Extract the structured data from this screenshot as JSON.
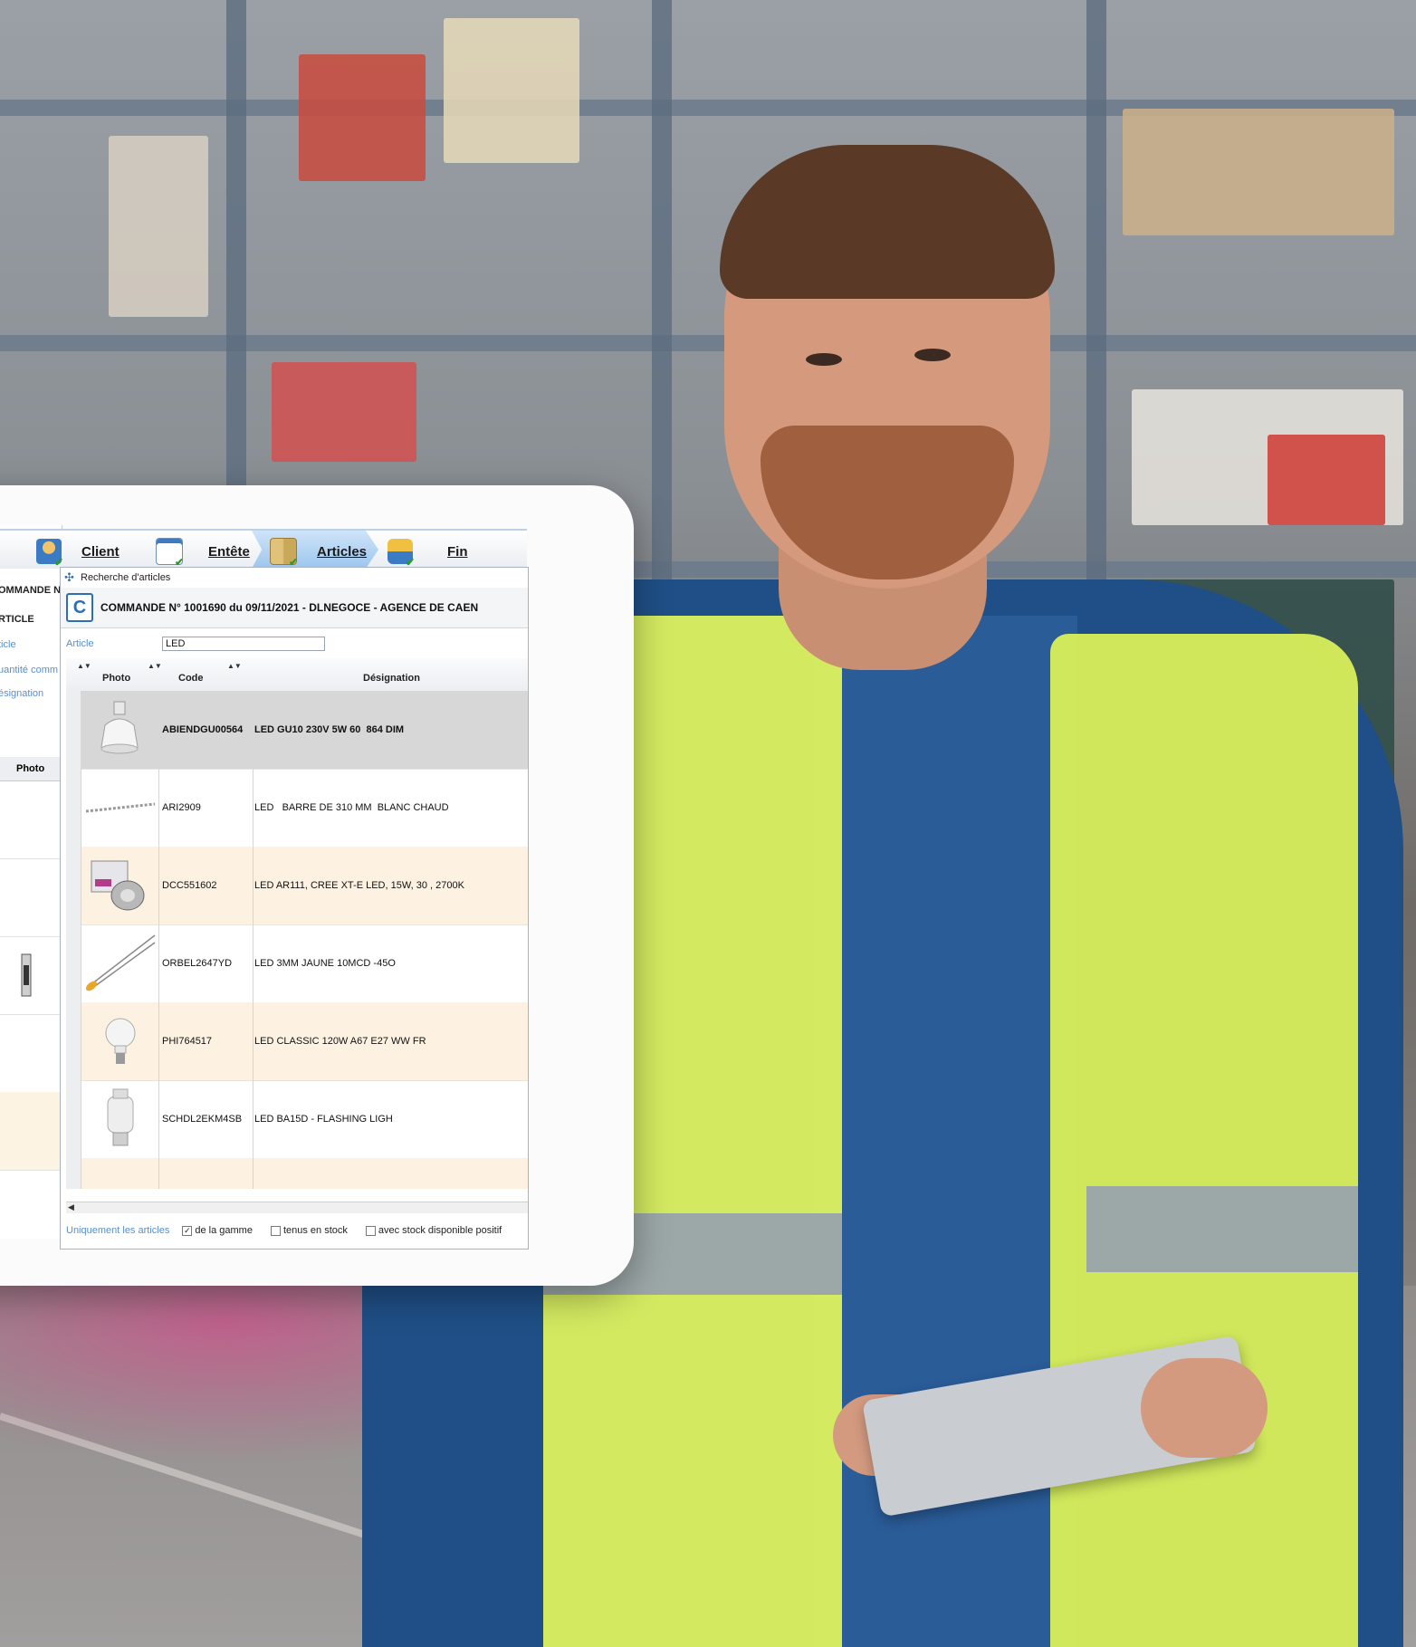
{
  "wizard": {
    "steps": [
      {
        "label": "Client",
        "icon": "client-icon"
      },
      {
        "label": "Entête",
        "icon": "header-form-icon"
      },
      {
        "label": "Articles",
        "icon": "articles-icon",
        "active": true
      },
      {
        "label": "Fin",
        "icon": "finish-truck-icon"
      }
    ]
  },
  "back_window": {
    "order_prefix": "OMMANDE N",
    "section": "RTICLE",
    "field_article": "ticle",
    "field_qty": "uantité comm",
    "field_desig": "ésignation",
    "col_photo": "Photo"
  },
  "dialog": {
    "title": "Recherche d'articles",
    "order_header": "COMMANDE N° 1001690 du 09/11/2021 - DLNEGOCE - AGENCE DE CAEN",
    "article_label": "Article",
    "article_value": "LED",
    "columns": {
      "photo": "Photo",
      "code": "Code",
      "designation": "Désignation"
    },
    "rows": [
      {
        "code": "ABIENDGU00564",
        "designation": "LED GU10 230V 5W 60  864 DIM",
        "photo": "gu10-spot-bulb"
      },
      {
        "code": "ARI2909",
        "designation": "LED   BARRE DE 310 MM  BLANC CHAUD",
        "photo": "led-bar-strip"
      },
      {
        "code": "DCC551602",
        "designation": "LED AR111, CREE XT-E LED, 15W, 30 , 2700K",
        "photo": "ar111-lamp-box"
      },
      {
        "code": "ORBEL2647YD",
        "designation": "LED 3MM JAUNE 10MCD -45O",
        "photo": "3mm-yellow-led"
      },
      {
        "code": "PHI764517",
        "designation": "LED CLASSIC 120W A67 E27 WW FR",
        "photo": "a67-classic-bulb"
      },
      {
        "code": "SCHDL2EKM4SB",
        "designation": "LED BA15D - FLASHING LIGH",
        "photo": "ba15d-indicator"
      }
    ],
    "filters": {
      "label": "Uniquement les articles",
      "options": [
        {
          "label": "de la gamme",
          "checked": true
        },
        {
          "label": "tenus en stock",
          "checked": false
        },
        {
          "label": "avec stock disponible positif",
          "checked": false
        }
      ]
    }
  },
  "colors": {
    "accent_blue": "#2f6db5",
    "label_blue": "#5a8fc8",
    "selected_row": "#d7d7d8",
    "alt_row": "#fdf2e2",
    "vest_yellow": "#d9ee5f",
    "jacket_blue": "#1f4f86"
  }
}
